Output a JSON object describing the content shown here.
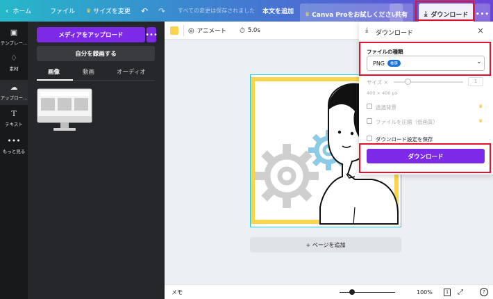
{
  "topbar": {
    "home": "ホーム",
    "file": "ファイル",
    "resize": "サイズを変更",
    "saved_status": "すべての変更は保存されました",
    "add_text": "本文を追加",
    "canva_pro": "Canva Proをお試しください",
    "share": "共有",
    "download": "ダウンロード",
    "more": "•••"
  },
  "sidenav": {
    "items": [
      {
        "label": "テンプレー..."
      },
      {
        "label": "素材"
      },
      {
        "label": "アップロー..."
      },
      {
        "label": "テキスト"
      },
      {
        "label": "もっと見る"
      }
    ]
  },
  "panel": {
    "upload_media": "メディアをアップロード",
    "upload_more": "•••",
    "record": "自分を録画する",
    "tabs": [
      "画像",
      "動画",
      "オーディオ"
    ]
  },
  "toolbar": {
    "animate": "アニメート",
    "duration": "5.0s"
  },
  "canvas": {
    "add_page": "+ ページを追加"
  },
  "bottombar": {
    "memo": "メモ",
    "zoom": "100%",
    "page_count": "1",
    "help": "?"
  },
  "download_panel": {
    "title": "ダウンロード",
    "file_type_label": "ファイルの種類",
    "file_type_value": "PNG",
    "file_type_badge": "推奨",
    "size_label": "サイズ ×",
    "size_value": "1",
    "dimensions": "400 × 400 px",
    "transparent_bg": "透過背景",
    "compress": "ファイルを圧縮（低画質）",
    "save_settings": "ダウンロード設定を保存",
    "download_button": "ダウンロード"
  },
  "colors": {
    "accent": "#7d2ae8",
    "highlight": "#e8112d",
    "badge": "#1771d9",
    "swatch": "#f8d54c"
  }
}
